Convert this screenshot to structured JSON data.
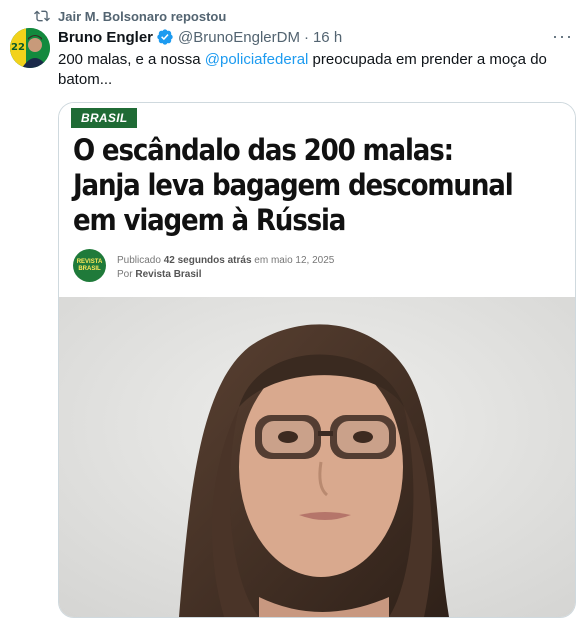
{
  "repost": {
    "text": "Jair M. Bolsonaro repostou",
    "icon": "repost-icon"
  },
  "author": {
    "name": "Bruno Engler",
    "handle": "@BrunoEnglerDM",
    "time": "16 h",
    "dot": "·",
    "verified_icon": "verified-badge-icon",
    "avatar_badge": "22"
  },
  "tweet": {
    "text_before": "200 malas, e a nossa ",
    "mention": "@policiafederal",
    "text_after": " preocupada em prender a moça do batom..."
  },
  "menu": {
    "more_label": "···"
  },
  "article": {
    "category": "BRASIL",
    "headline": "O escândalo das 200 malas: Janja leva bagagem descomunal em viagem à Rússia",
    "published_prefix": "Publicado ",
    "published_ago": "42 segundos atrás",
    "published_suffix": " em maio 12, 2025",
    "by_prefix": "Por ",
    "by_name": "Revista Brasil",
    "logo_text": "REVISTA BRASIL"
  },
  "colors": {
    "accent": "#1d9bf0",
    "muted": "#536471",
    "tag_green": "#1f6b35"
  }
}
